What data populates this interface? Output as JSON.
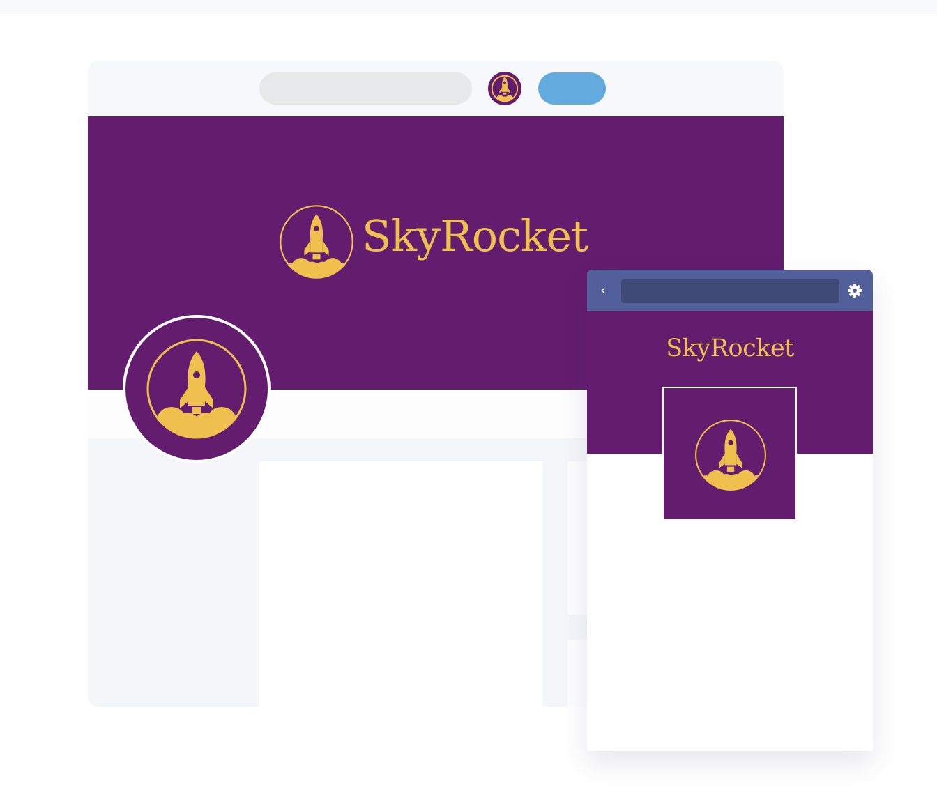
{
  "brand": {
    "name": "SkyRocket",
    "logo_icon": "rocket-launch-icon"
  },
  "colors": {
    "brand_purple": "#641c6f",
    "brand_gold": "#efc04e",
    "desktop_button": "#63aadf",
    "mobile_topbar": "#525f9b",
    "mobile_urlbar": "#3f4a77"
  },
  "desktop": {
    "cover_title": "SkyRocket"
  },
  "mobile": {
    "cover_title": "SkyRocket",
    "back_glyph": "‹",
    "back_icon": "chevron-left-icon",
    "settings_icon": "gear-icon"
  }
}
